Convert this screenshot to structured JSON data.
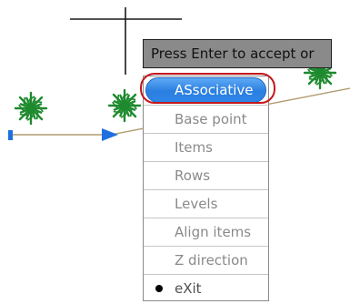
{
  "prompt": {
    "text": "Press Enter to accept or"
  },
  "menu": {
    "items": [
      {
        "label": "ASsociative",
        "state": "highlighted"
      },
      {
        "label": "Base point",
        "state": "normal"
      },
      {
        "label": "Items",
        "state": "normal"
      },
      {
        "label": "Rows",
        "state": "normal"
      },
      {
        "label": "Levels",
        "state": "normal"
      },
      {
        "label": "Align items",
        "state": "normal"
      },
      {
        "label": "Z direction",
        "state": "normal"
      },
      {
        "label": "eXit",
        "state": "current"
      }
    ]
  },
  "colors": {
    "path_line": "#b09a6e",
    "tree": "#1e8a2e",
    "arrow": "#1f6fe0",
    "highlight_ring": "#c4171c",
    "prompt_bg": "#8a8a8a"
  },
  "icons": [
    "crosshair-cursor-icon",
    "tree-block-icon",
    "path-direction-arrow-icon",
    "selected-bullet-icon"
  ]
}
